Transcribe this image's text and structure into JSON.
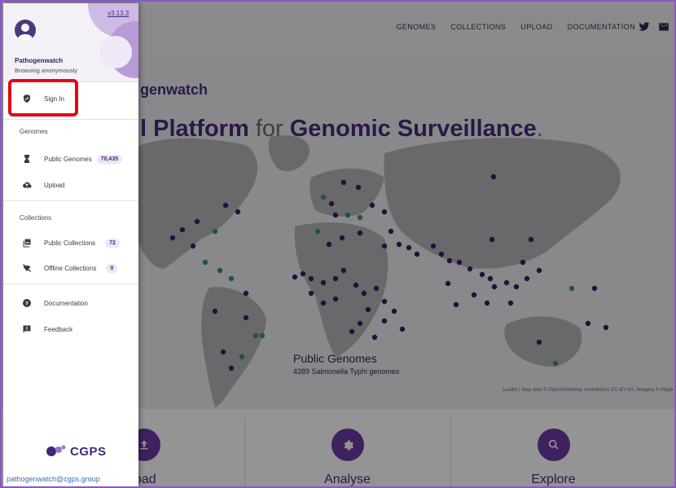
{
  "topnav": {
    "links": [
      "GENOMES",
      "COLLECTIONS",
      "UPLOAD",
      "DOCUMENTATION"
    ],
    "icons": [
      "twitter-icon",
      "mail-icon"
    ]
  },
  "hero": {
    "brand_partial": "genwatch",
    "headline_part1": "l Platform",
    "headline_part2": "for",
    "headline_part3": "Genomic Surveillance",
    "headline_end": ".",
    "caption_title": "Public Genomes",
    "caption_sub": "4389 Salmonella Typhi genomes",
    "credits_prefix": "Leaflet | Map data ©",
    "credits_link1": "OpenStreetMap",
    "credits_mid": "contributors",
    "credits_link2": "CC-BY-SA",
    "credits_suffix": ", Imagery © Mapb"
  },
  "features": [
    {
      "label": "load",
      "icon": "upload-icon"
    },
    {
      "label": "Analyse",
      "icon": "gear-icon"
    },
    {
      "label": "Explore",
      "icon": "search-icon"
    }
  ],
  "drawer": {
    "version": "v3.13.3",
    "user_name": "Pathogenwatch",
    "user_status": "Browsing anonymously",
    "sign_in": "Sign In",
    "genomes_section": "Genomes",
    "public_genomes": "Public Genomes",
    "public_genomes_count": "70,435",
    "upload": "Upload",
    "collections_section": "Collections",
    "public_collections": "Public Collections",
    "public_collections_count": "72",
    "offline_collections": "Offline Collections",
    "offline_collections_count": "0",
    "documentation": "Documentation",
    "feedback": "Feedback",
    "org_logo_text": "CGPS",
    "email": "pathogenwatch@cgps.group"
  },
  "colors": {
    "accent": "#4a2a7a",
    "highlight": "#e30613",
    "dots_primary": "#3f1d6e",
    "dots_secondary": "#3c8a88"
  }
}
